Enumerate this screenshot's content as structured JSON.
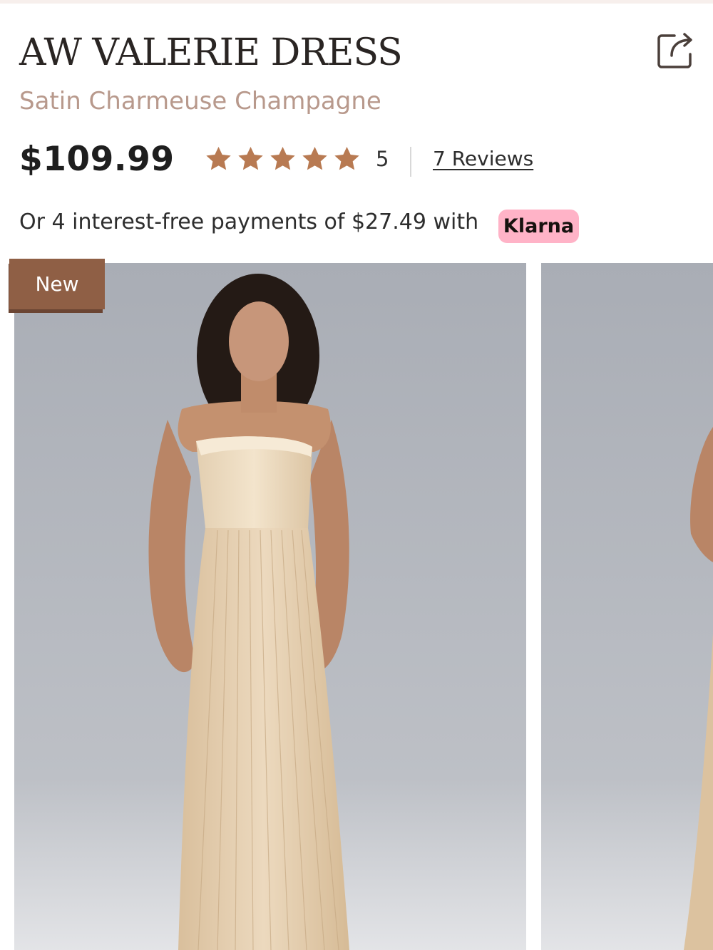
{
  "product": {
    "title": "AW VALERIE DRESS",
    "subtitle": "Satin Charmeuse Champagne",
    "price": "$109.99"
  },
  "rating": {
    "value": 5,
    "max": 5,
    "display": "5",
    "reviews_label": "7 Reviews",
    "star_color": "#b87a52"
  },
  "payments": {
    "text": "Or 4 interest-free payments of $27.49 with",
    "provider": "Klarna",
    "badge_color": "#ffb3c7"
  },
  "gallery": {
    "badge": "New",
    "badge_color": "#8f5f45",
    "images": [
      {
        "alt": "Model wearing strapless pleated champagne dress, front view"
      },
      {
        "alt": "Dress alternate view"
      }
    ]
  },
  "icons": {
    "share": "share-icon",
    "star": "star-icon"
  }
}
